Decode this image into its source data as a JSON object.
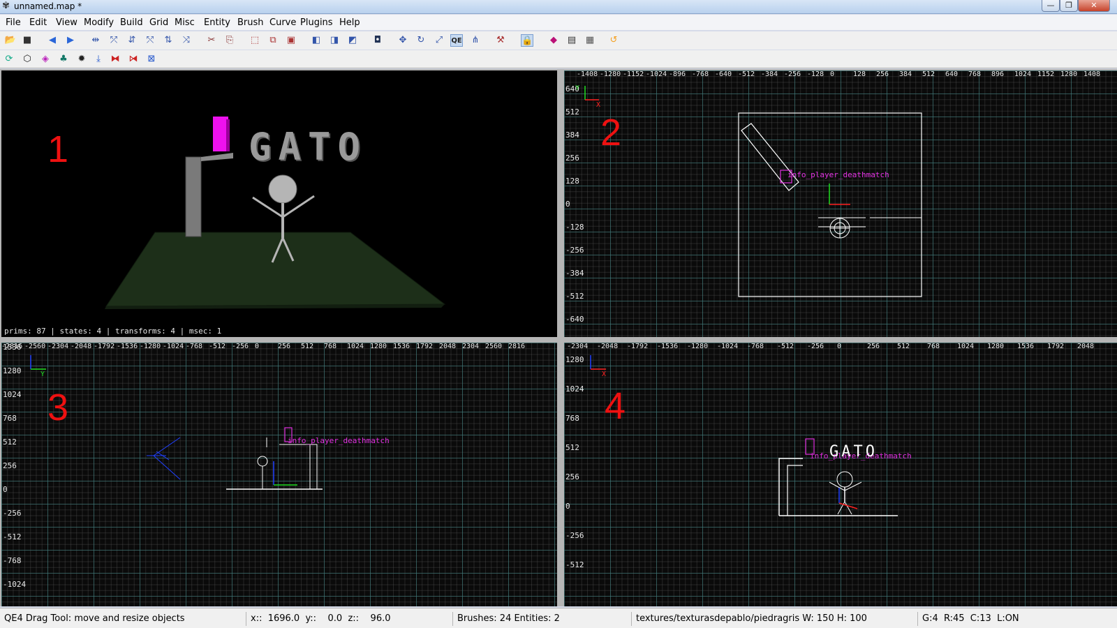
{
  "window": {
    "title": "unnamed.map *",
    "app_icon": "gear-icon",
    "controls": {
      "minimize": "—",
      "maximize": "❐",
      "close": "✕"
    }
  },
  "menu": [
    "File",
    "Edit",
    "View",
    "Modify",
    "Build",
    "Grid",
    "Misc",
    "Entity",
    "Brush",
    "Curve",
    "Plugins",
    "Help"
  ],
  "toolbar1": [
    {
      "icon": "open-folder-icon",
      "glyph": "📂",
      "color": "#c8962a"
    },
    {
      "icon": "save-disk-icon",
      "glyph": "■",
      "color": "#333333"
    },
    {
      "icon": "undo-arrow-icon",
      "glyph": "◀",
      "color": "#2a66d8"
    },
    {
      "icon": "redo-arrow-icon",
      "glyph": "▶",
      "color": "#2a66d8"
    },
    {
      "icon": "flip-x-icon",
      "glyph": "⇹",
      "color": "#3355aa"
    },
    {
      "icon": "rotate-x-icon",
      "glyph": "⤱",
      "color": "#3355aa"
    },
    {
      "icon": "flip-y-icon",
      "glyph": "⇵",
      "color": "#3355aa"
    },
    {
      "icon": "rotate-y-icon",
      "glyph": "⤲",
      "color": "#3355aa"
    },
    {
      "icon": "flip-z-icon",
      "glyph": "⇅",
      "color": "#3355aa"
    },
    {
      "icon": "rotate-z-icon",
      "glyph": "⤨",
      "color": "#3355aa"
    },
    {
      "icon": "clipper-icon",
      "glyph": "✂",
      "color": "#883333"
    },
    {
      "icon": "clip-split-icon",
      "glyph": "⎘",
      "color": "#883333"
    },
    {
      "icon": "select-complete-icon",
      "glyph": "⬚",
      "color": "#aa3333"
    },
    {
      "icon": "select-partial-icon",
      "glyph": "⧉",
      "color": "#aa3333"
    },
    {
      "icon": "select-touching-icon",
      "glyph": "▣",
      "color": "#aa3333"
    },
    {
      "icon": "csg-subtract-icon",
      "glyph": "◧",
      "color": "#3355aa"
    },
    {
      "icon": "csg-hollow-icon",
      "glyph": "◨",
      "color": "#3355aa"
    },
    {
      "icon": "csg-merge-icon",
      "glyph": "◩",
      "color": "#3355aa"
    },
    {
      "icon": "camera-icon",
      "glyph": "◘",
      "color": "#223355"
    },
    {
      "icon": "translate-icon",
      "glyph": "✥",
      "color": "#3355aa"
    },
    {
      "icon": "rotate-tool-icon",
      "glyph": "↻",
      "color": "#3355aa"
    },
    {
      "icon": "scale-tool-icon",
      "glyph": "⤢",
      "color": "#3355aa"
    },
    {
      "icon": "qe-drag-tool-icon",
      "glyph": "QE",
      "color": "#222222",
      "active": true
    },
    {
      "icon": "vertex-edit-icon",
      "glyph": "⋔",
      "color": "#3355aa"
    },
    {
      "icon": "texture-lock-icon",
      "glyph": "⚒",
      "color": "#aa3333"
    },
    {
      "icon": "lock-icon",
      "glyph": "🔒",
      "color": "#aa7700",
      "active": true
    },
    {
      "icon": "entity-list-icon",
      "glyph": "◆",
      "color": "#bb1177"
    },
    {
      "icon": "console-icon",
      "glyph": "▤",
      "color": "#333333"
    },
    {
      "icon": "texture-browser-icon",
      "glyph": "▦",
      "color": "#555555"
    },
    {
      "icon": "plugin-refresh-icon",
      "glyph": "↺",
      "color": "#f5a020"
    }
  ],
  "toolbar2": [
    {
      "icon": "refresh-icon",
      "glyph": "⟳",
      "color": "#11aa88"
    },
    {
      "icon": "cylinder-icon",
      "glyph": "⬡",
      "color": "#222222"
    },
    {
      "icon": "patch-icon",
      "glyph": "◈",
      "color": "#bb22bb"
    },
    {
      "icon": "tree-icon",
      "glyph": "♣",
      "color": "#117766"
    },
    {
      "icon": "monster-icon",
      "glyph": "✹",
      "color": "#222222"
    },
    {
      "icon": "gravity-icon",
      "glyph": "⤓",
      "color": "#2255cc"
    },
    {
      "icon": "mirror-icon",
      "glyph": "⧓",
      "color": "#cc2222"
    },
    {
      "icon": "mirror-split-icon",
      "glyph": "⧒",
      "color": "#cc2222"
    },
    {
      "icon": "clear-icon",
      "glyph": "⊠",
      "color": "#2255cc"
    }
  ],
  "viewports": {
    "camera": {
      "number": "1",
      "stats": "prims: 87 | states: 4 | transforms: 4 | msec: 1",
      "title_text": "GATO"
    },
    "top": {
      "number": "2",
      "ruler_x": [
        "-1408",
        "-1280",
        "-1152",
        "-1024",
        "-896",
        "-768",
        "-640",
        "-512",
        "-384",
        "-256",
        "-128",
        "0",
        "128",
        "256",
        "384",
        "512",
        "640",
        "768",
        "896",
        "1024",
        "1152",
        "1280",
        "1408"
      ],
      "ruler_y": [
        "640",
        "512",
        "384",
        "256",
        "128",
        "0",
        "-128",
        "-256",
        "-384",
        "-512",
        "-640"
      ],
      "axis": {
        "h": "X",
        "v": "Y"
      },
      "entity_label": "info_player_deathmatch"
    },
    "side": {
      "number": "3",
      "ruler_x": [
        "-2816",
        "-2560",
        "-2304",
        "-2048",
        "-1792",
        "-1536",
        "-1280",
        "-1024",
        "-768",
        "-512",
        "-256",
        "0",
        "256",
        "512",
        "768",
        "1024",
        "1280",
        "1536",
        "1792",
        "2048",
        "2304",
        "2560",
        "2816"
      ],
      "ruler_y": [
        "1536",
        "1280",
        "1024",
        "768",
        "512",
        "256",
        "0",
        "-256",
        "-512",
        "-768",
        "-1024"
      ],
      "axis": {
        "h": "Y",
        "v": "Z"
      },
      "entity_label": "info_player_deathmatch"
    },
    "front": {
      "number": "4",
      "ruler_x": [
        "-2304",
        "-2048",
        "-1792",
        "-1536",
        "-1280",
        "-1024",
        "-768",
        "-512",
        "-256",
        "0",
        "256",
        "512",
        "768",
        "1024",
        "1280",
        "1536",
        "1792",
        "2048"
      ],
      "ruler_y": [
        "1280",
        "1024",
        "768",
        "512",
        "256",
        "0",
        "-256",
        "-512"
      ],
      "axis": {
        "h": "X",
        "v": "Z"
      },
      "entity_label": "info_player_deathmatch",
      "overlay_text": "GATO"
    }
  },
  "status": {
    "tool": "QE4 Drag Tool: move and resize objects",
    "coords": "x::  1696.0  y::    0.0  z::    96.0",
    "counts": "Brushes: 24 Entities: 2",
    "texture": "textures/texturasdepablo/piedragris W: 150 H: 100",
    "grid": "G:4  R:45  C:13  L:ON"
  },
  "colors": {
    "number_red": "#e11111",
    "entity_magenta": "#e030e0",
    "grid_major": "#3c8282",
    "brush_white": "#ffffff",
    "axis_x": "#ff2020",
    "axis_y": "#20dd20",
    "axis_z": "#2040ff"
  }
}
